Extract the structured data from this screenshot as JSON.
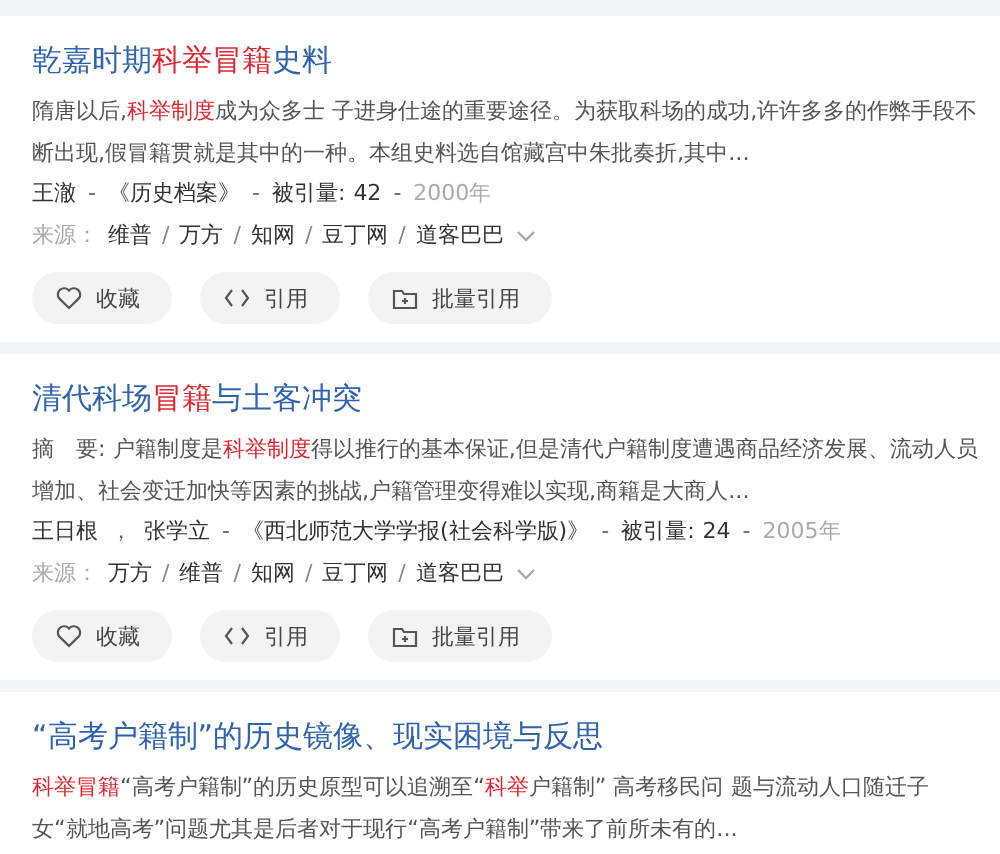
{
  "results": [
    {
      "title": [
        {
          "text": "乾嘉时期",
          "hl": false
        },
        {
          "text": "科举冒籍",
          "hl": true
        },
        {
          "text": "史料",
          "hl": false
        }
      ],
      "snippet": [
        {
          "text": "隋唐以后,",
          "hl": false
        },
        {
          "text": "科举制度",
          "hl": true
        },
        {
          "text": "成为众多士 子进身仕途的重要途径。为获取科场的成功,许许多多的作弊手段不断出现,假冒籍贯就是其中的一种。本组史料选自馆藏宫中朱批奏折,其中...",
          "hl": false
        }
      ],
      "authors": [
        "王澈"
      ],
      "journal": "《历史档案》",
      "cite_label": "被引量:",
      "cites": "42",
      "year": "2000年",
      "separator": "-",
      "sources_label": "来源：",
      "sources": [
        "维普",
        "万方",
        "知网",
        "豆丁网",
        "道客巴巴"
      ],
      "source_separator": "/",
      "actions": [
        {
          "kind": "favorite",
          "label": "收藏"
        },
        {
          "kind": "cite",
          "label": "引用"
        },
        {
          "kind": "batch",
          "label": "批量引用"
        }
      ]
    },
    {
      "title": [
        {
          "text": "清代科场",
          "hl": false
        },
        {
          "text": "冒籍",
          "hl": true
        },
        {
          "text": "与土客冲突",
          "hl": false
        }
      ],
      "snippet": [
        {
          "text": "摘　要: 户籍制度是",
          "hl": false
        },
        {
          "text": "科举制度",
          "hl": true
        },
        {
          "text": "得以推行的基本保证,但是清代户籍制度遭遇商品经济发展、流动人员增加、社会变迁加快等因素的挑战,户籍管理变得难以实现,商籍是大商人...",
          "hl": false
        }
      ],
      "authors": [
        "王日根",
        "张学立"
      ],
      "author_separator": "，",
      "journal": "《西北师范大学学报(社会科学版)》",
      "cite_label": "被引量:",
      "cites": "24",
      "year": "2005年",
      "separator": "-",
      "sources_label": "来源：",
      "sources": [
        "万方",
        "维普",
        "知网",
        "豆丁网",
        "道客巴巴"
      ],
      "source_separator": "/",
      "actions": [
        {
          "kind": "favorite",
          "label": "收藏"
        },
        {
          "kind": "cite",
          "label": "引用"
        },
        {
          "kind": "batch",
          "label": "批量引用"
        }
      ]
    },
    {
      "title": [
        {
          "text": "“高考户籍制”的历史镜像、现实困境与反思",
          "hl": false
        }
      ],
      "snippet": [
        {
          "text": "科举冒籍",
          "hl": true
        },
        {
          "text": "“高考户籍制”的历史原型可以追溯至“",
          "hl": false
        },
        {
          "text": "科举",
          "hl": true
        },
        {
          "text": "户籍制” 高考移民问 题与流动人口随迁子女“就地高考”问题尤其是后者对于现行“高考户籍制”带来了前所未有的...",
          "hl": false
        }
      ]
    }
  ]
}
